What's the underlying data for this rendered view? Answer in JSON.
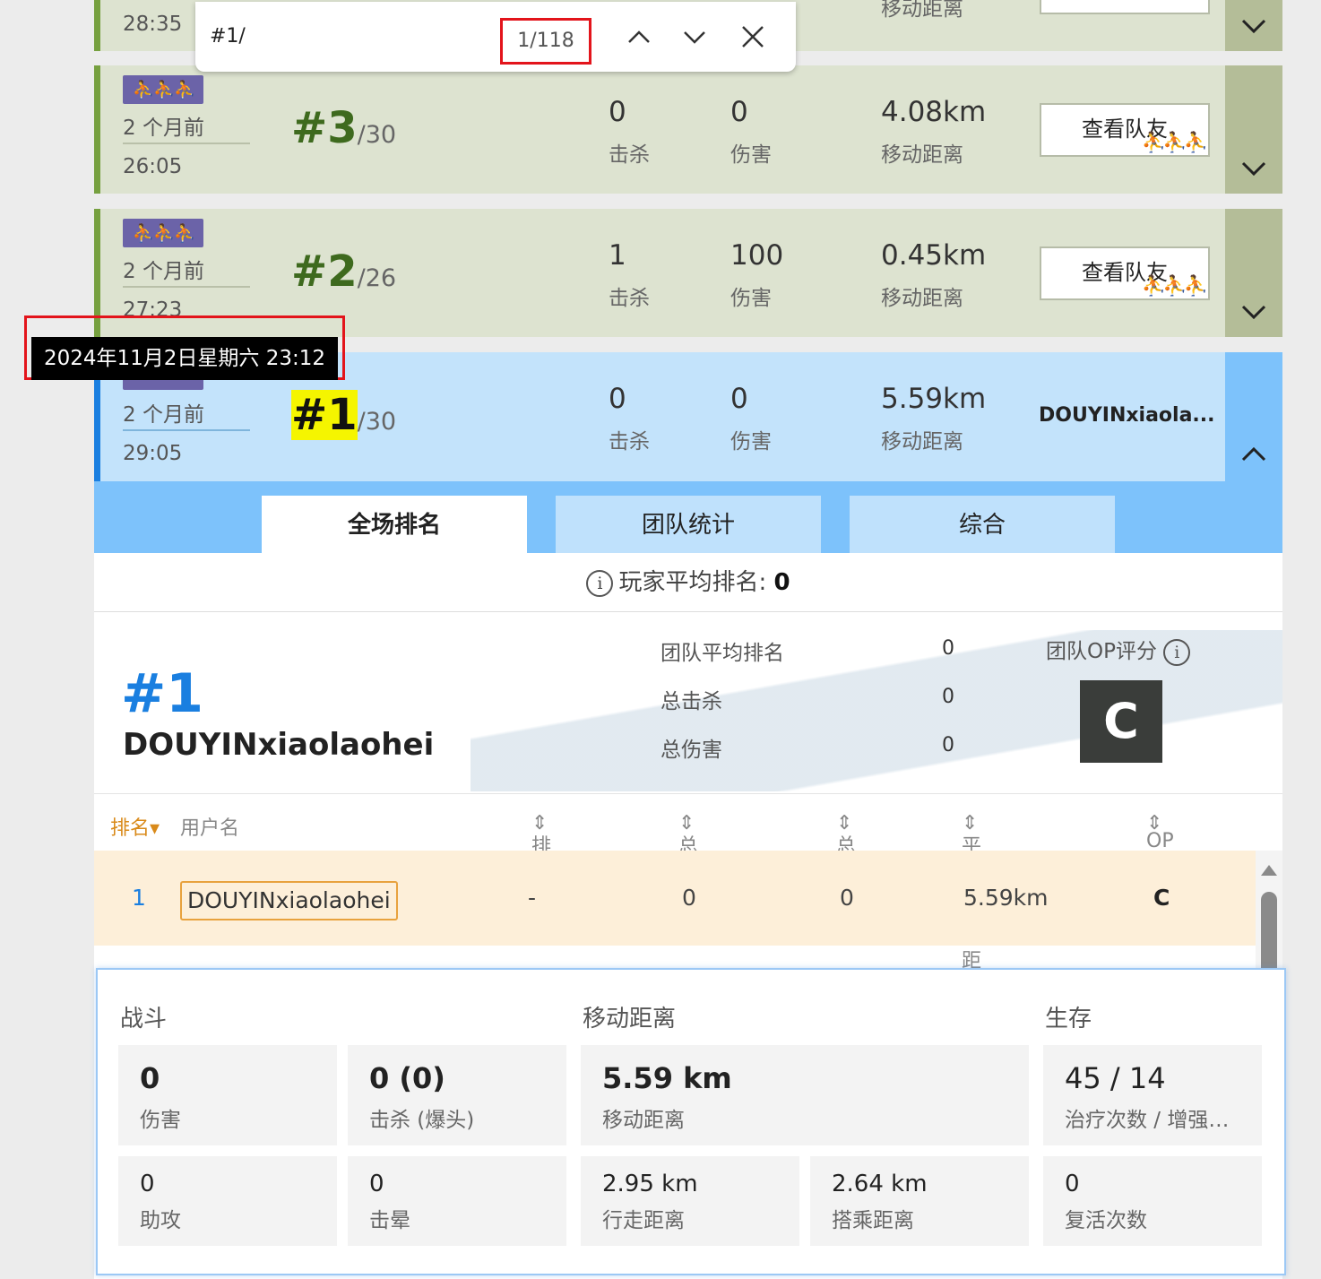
{
  "find_bar": {
    "query": "#1/",
    "count": "1/118"
  },
  "tooltip": "2024年11月2日星期六 23:12",
  "matches": [
    {
      "ago": "",
      "duration": "28:35",
      "distance_label": "移动距离"
    },
    {
      "mode": "⛹⛹⛹",
      "ago": "2 个月前",
      "duration": "26:05",
      "rank": "#3",
      "of": "/30",
      "kills": "0",
      "kills_label": "击杀",
      "damage": "0",
      "damage_label": "伤害",
      "distance": "4.08km",
      "distance_label": "移动距离",
      "button": "查看队友"
    },
    {
      "mode": "⛹⛹⛹",
      "ago": "2 个月前",
      "duration": "27:23",
      "rank": "#2",
      "of": "/26",
      "kills": "1",
      "kills_label": "击杀",
      "damage": "100",
      "damage_label": "伤害",
      "distance": "0.45km",
      "distance_label": "移动距离",
      "button": "查看队友"
    },
    {
      "ago": "2 个月前",
      "duration": "29:05",
      "rank": "#1",
      "of": "/30",
      "kills": "0",
      "kills_label": "击杀",
      "damage": "0",
      "damage_label": "伤害",
      "distance": "5.59km",
      "distance_label": "移动距离",
      "player": "DOUYINxiaola..."
    }
  ],
  "tabs": [
    "全场排名",
    "团队统计",
    "综合"
  ],
  "avg_rank": {
    "label": "玩家平均排名:",
    "value": "0"
  },
  "team": {
    "rank": "#1",
    "name": "DOUYINxiaolaohei",
    "stats": [
      {
        "label": "团队平均排名",
        "value": "0"
      },
      {
        "label": "总击杀",
        "value": "0"
      },
      {
        "label": "总伤害",
        "value": "0"
      }
    ],
    "op_label": "团队OP评分",
    "op_grade": "C"
  },
  "table": {
    "headers": {
      "rank": "排名▾",
      "user": "用户名",
      "place": "排名",
      "kills": "总击杀",
      "damage": "总伤害",
      "distance": "平均移动距离",
      "op": "OP评分"
    },
    "row": {
      "rank": "1",
      "user": "DOUYINxiaolaohei",
      "place": "-",
      "kills": "0",
      "damage": "0",
      "distance": "5.59km",
      "op": "C"
    }
  },
  "panel": {
    "sections": {
      "combat": "战斗",
      "distance": "移动距离",
      "survival": "生存"
    },
    "damage": {
      "value": "0",
      "label": "伤害"
    },
    "kills": {
      "value": "0 (0)",
      "label": "击杀 (爆头)"
    },
    "move": {
      "value": "5.59 km",
      "label": "移动距离"
    },
    "heals": {
      "value": "45 / 14",
      "label": "治疗次数 / 增强…"
    },
    "assists": {
      "value": "0",
      "label": "助攻"
    },
    "dbnos": {
      "value": "0",
      "label": "击晕"
    },
    "walk": {
      "value": "2.95 km",
      "label": "行走距离"
    },
    "ride": {
      "value": "2.64 km",
      "label": "搭乘距离"
    },
    "revives": {
      "value": "0",
      "label": "复活次数"
    }
  }
}
